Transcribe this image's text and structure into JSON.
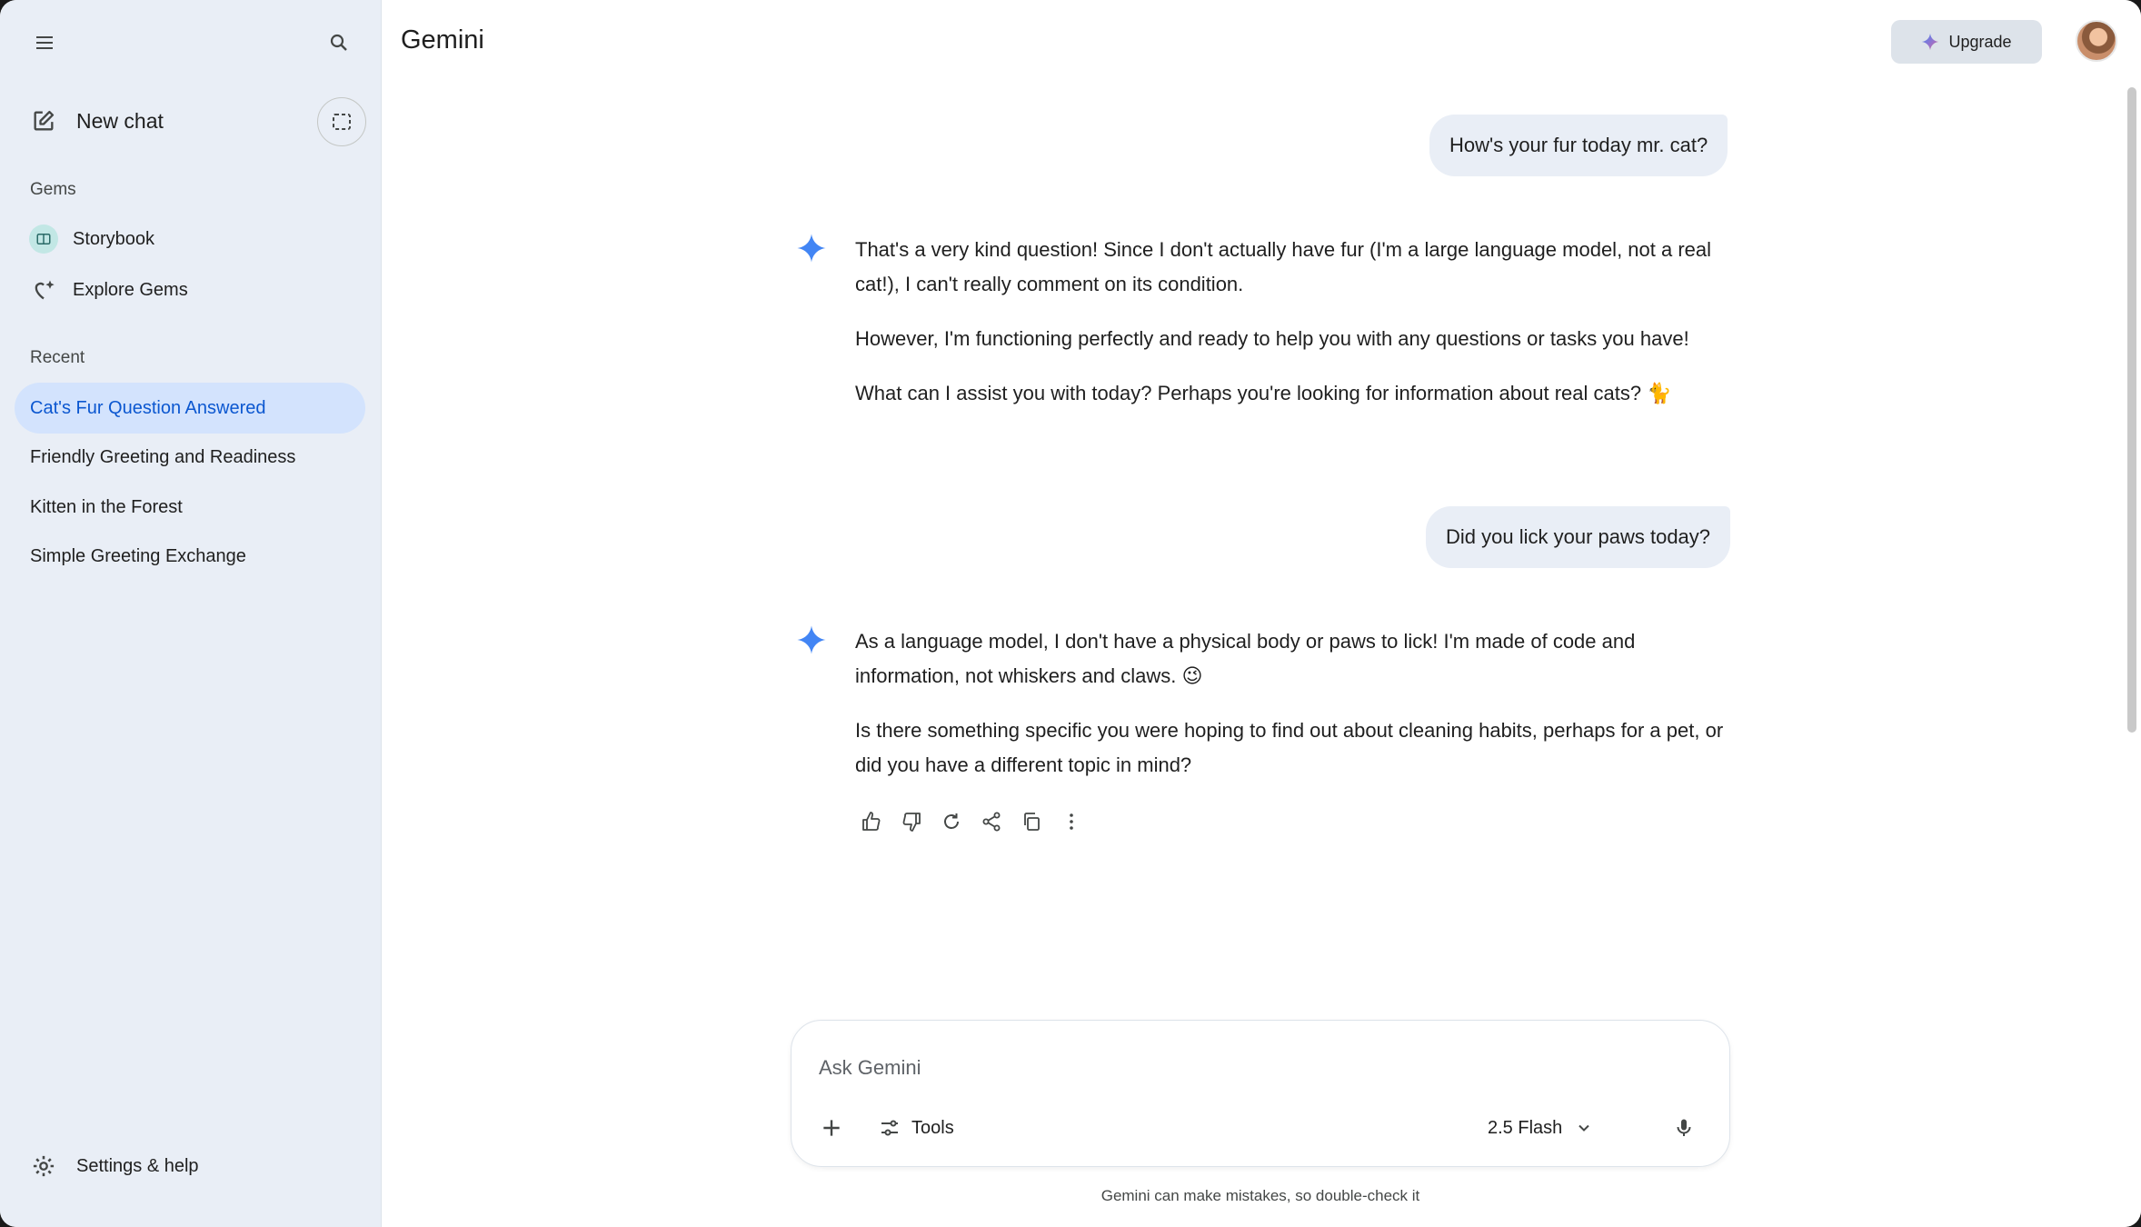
{
  "app": {
    "title": "Gemini"
  },
  "sidebar": {
    "new_chat_label": "New chat",
    "gems_label": "Gems",
    "gems": [
      {
        "label": "Storybook",
        "icon": "book-icon"
      },
      {
        "label": "Explore Gems",
        "icon": "gem-sparkle-icon"
      }
    ],
    "recent_label": "Recent",
    "recent": [
      {
        "label": "Cat's Fur Question Answered",
        "active": true
      },
      {
        "label": "Friendly Greeting and Readiness",
        "active": false
      },
      {
        "label": "Kitten in the Forest",
        "active": false
      },
      {
        "label": "Simple Greeting Exchange",
        "active": false
      }
    ],
    "settings_label": "Settings & help"
  },
  "header": {
    "upgrade_label": "Upgrade"
  },
  "conversation": [
    {
      "role": "user",
      "text": "How's your fur today mr. cat?"
    },
    {
      "role": "model",
      "paragraphs": [
        "That's a very kind question! Since I don't actually have fur (I'm a large language model, not a real cat!), I can't really comment on its condition.",
        "However, I'm functioning perfectly and ready to help you with any questions or tasks you have!",
        "What can I assist you with today? Perhaps you're looking for information about real cats? 🐈"
      ]
    },
    {
      "role": "user",
      "text": "Did you lick your paws today?"
    },
    {
      "role": "model",
      "paragraphs": [
        "As a language model, I don't have a physical body or paws to lick! I'm made of code and information, not whiskers and claws. 😉",
        "Is there something specific you were hoping to find out about cleaning habits, perhaps for a pet, or did you have a different topic in mind?"
      ]
    }
  ],
  "composer": {
    "placeholder": "Ask Gemini",
    "value": "",
    "tools_label": "Tools",
    "model_label": "2.5 Flash"
  },
  "disclaimer": "Gemini can make mistakes, so double-check it",
  "colors": {
    "sidebar_bg": "#e9eef6",
    "active_item_bg": "#d3e3fd",
    "active_item_text": "#0b57d0",
    "spark_blue": "#4285f4"
  }
}
